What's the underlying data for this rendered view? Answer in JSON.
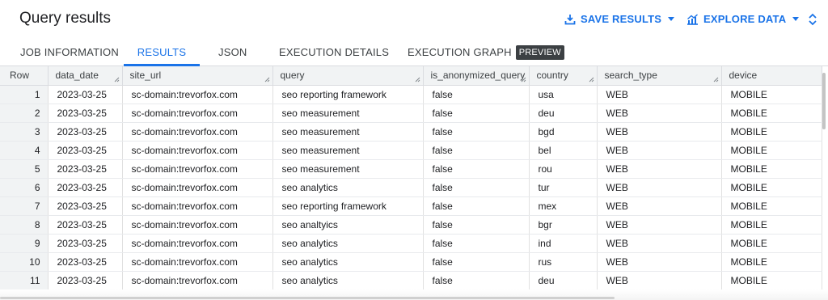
{
  "header": {
    "title": "Query results",
    "save_results": "SAVE RESULTS",
    "explore_data": "EXPLORE DATA"
  },
  "tabs": [
    {
      "label": "JOB INFORMATION"
    },
    {
      "label": "RESULTS",
      "active": true
    },
    {
      "label": "JSON"
    },
    {
      "label": "EXECUTION DETAILS"
    },
    {
      "label": "EXECUTION GRAPH",
      "badge": "PREVIEW"
    }
  ],
  "table": {
    "columns": [
      "Row",
      "data_date",
      "site_url",
      "query",
      "is_anonymized_query",
      "country",
      "search_type",
      "device"
    ],
    "rows": [
      [
        "1",
        "2023-03-25",
        "sc-domain:trevorfox.com",
        "seo reporting framework",
        "false",
        "usa",
        "WEB",
        "MOBILE"
      ],
      [
        "2",
        "2023-03-25",
        "sc-domain:trevorfox.com",
        "seo measurement",
        "false",
        "deu",
        "WEB",
        "MOBILE"
      ],
      [
        "3",
        "2023-03-25",
        "sc-domain:trevorfox.com",
        "seo measurement",
        "false",
        "bgd",
        "WEB",
        "MOBILE"
      ],
      [
        "4",
        "2023-03-25",
        "sc-domain:trevorfox.com",
        "seo measurement",
        "false",
        "bel",
        "WEB",
        "MOBILE"
      ],
      [
        "5",
        "2023-03-25",
        "sc-domain:trevorfox.com",
        "seo measurement",
        "false",
        "rou",
        "WEB",
        "MOBILE"
      ],
      [
        "6",
        "2023-03-25",
        "sc-domain:trevorfox.com",
        "seo analytics",
        "false",
        "tur",
        "WEB",
        "MOBILE"
      ],
      [
        "7",
        "2023-03-25",
        "sc-domain:trevorfox.com",
        "seo reporting framework",
        "false",
        "mex",
        "WEB",
        "MOBILE"
      ],
      [
        "8",
        "2023-03-25",
        "sc-domain:trevorfox.com",
        "seo analtyics",
        "false",
        "bgr",
        "WEB",
        "MOBILE"
      ],
      [
        "9",
        "2023-03-25",
        "sc-domain:trevorfox.com",
        "seo analytics",
        "false",
        "ind",
        "WEB",
        "MOBILE"
      ],
      [
        "10",
        "2023-03-25",
        "sc-domain:trevorfox.com",
        "seo analytics",
        "false",
        "rus",
        "WEB",
        "MOBILE"
      ],
      [
        "11",
        "2023-03-25",
        "sc-domain:trevorfox.com",
        "seo analytics",
        "false",
        "deu",
        "WEB",
        "MOBILE"
      ]
    ]
  },
  "colors": {
    "accent": "#1a73e8",
    "header_bg": "#f1f3f4",
    "badge_bg": "#3c4043"
  }
}
